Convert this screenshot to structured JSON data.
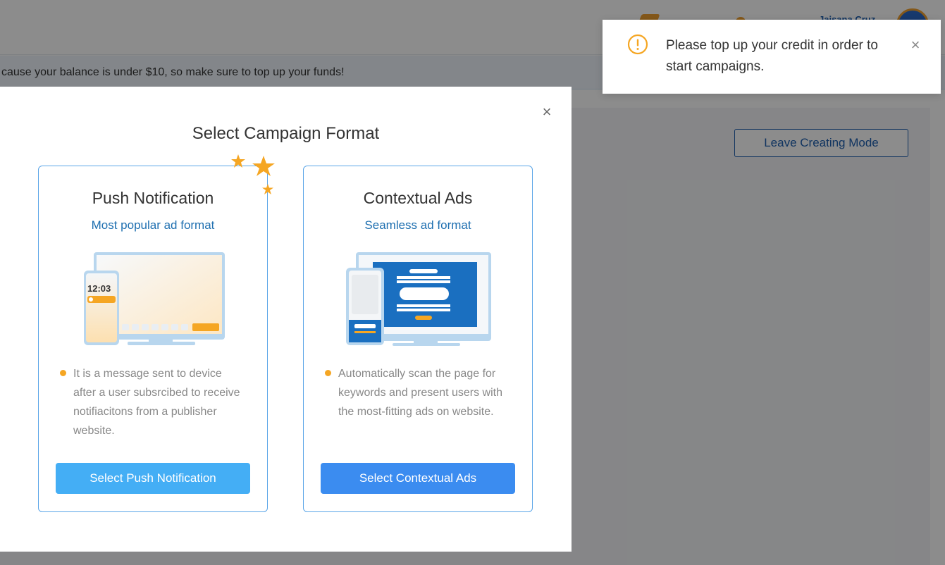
{
  "header": {
    "username": "Jaisana Cruz"
  },
  "banner": {
    "text": "cause your balance is under $10, so make sure to top up your funds!"
  },
  "toolbar": {
    "leave_label": "Leave Creating Mode"
  },
  "modal": {
    "title": "Select Campaign Format",
    "close_label": "×",
    "cards": [
      {
        "title": "Push Notification",
        "subtitle": "Most popular ad format",
        "phone_time": "12:03",
        "description": "It is a message sent to device after a user subsrcibed to receive notifiacitons from a publisher website.",
        "button_label": "Select Push Notification"
      },
      {
        "title": "Contextual Ads",
        "subtitle": "Seamless ad format",
        "description": "Automatically scan the page for keywords and present users with the most-fitting ads on website.",
        "button_label": "Select Contextual Ads"
      }
    ]
  },
  "toast": {
    "message": "Please top up your credit in order to start campaigns.",
    "close_label": "×",
    "icon": "warning-circle-icon"
  },
  "colors": {
    "accent": "#1e6fb0",
    "warning": "#f5a623",
    "push_button": "#44aef5",
    "contextual_button": "#3b8cf0"
  }
}
